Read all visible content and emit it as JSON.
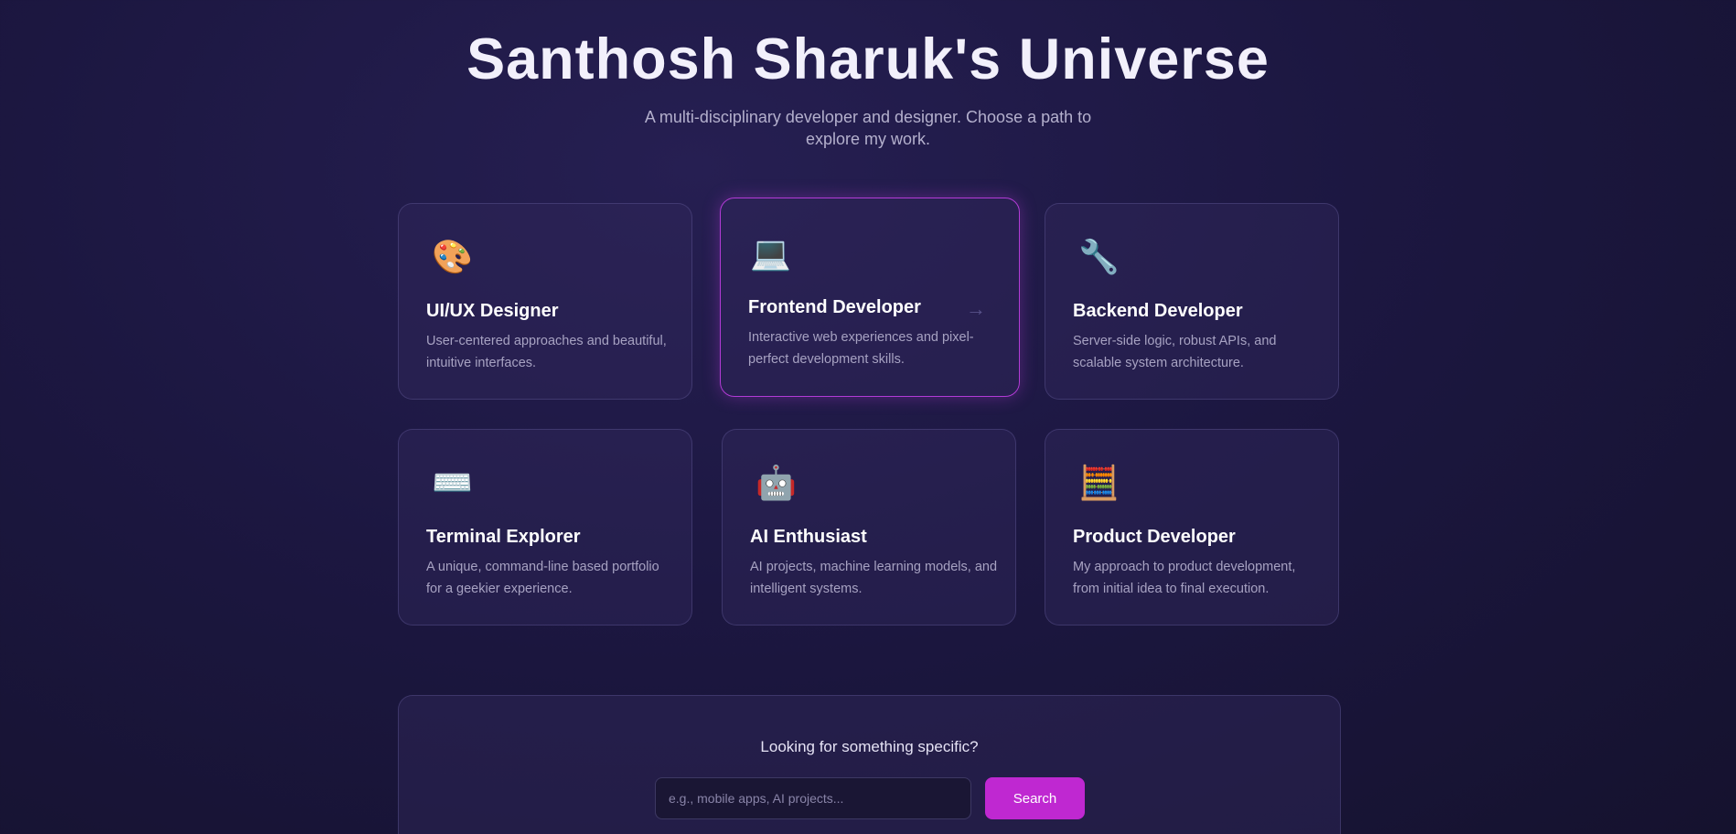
{
  "header": {
    "title": "Santhosh Sharuk's Universe",
    "subtitle": "A multi-disciplinary developer and designer. Choose a path to explore my work."
  },
  "cards": [
    {
      "icon": "palette-icon",
      "glyph": "🎨",
      "title": "UI/UX Designer",
      "description": "User-centered approaches and beautiful, intuitive interfaces."
    },
    {
      "icon": "laptop-icon",
      "glyph": "💻",
      "title": "Frontend Developer",
      "description": "Interactive web experiences and pixel-perfect development skills.",
      "arrow": "→"
    },
    {
      "icon": "wrench-icon",
      "glyph": "🔧",
      "title": "Backend Developer",
      "description": "Server-side logic, robust APIs, and scalable system architecture."
    },
    {
      "icon": "keyboard-icon",
      "glyph": "⌨️",
      "title": "Terminal Explorer",
      "description": "A unique, command-line based portfolio for a geekier experience."
    },
    {
      "icon": "robot-icon",
      "glyph": "🤖",
      "title": "AI Enthusiast",
      "description": "AI projects, machine learning models, and intelligent systems."
    },
    {
      "icon": "calculator-icon",
      "glyph": "🧮",
      "title": "Product Developer",
      "description": "My approach to product development, from initial idea to final execution."
    }
  ],
  "search": {
    "heading": "Looking for something specific?",
    "placeholder": "e.g., mobile apps, AI projects...",
    "button_label": "Search"
  },
  "colors": {
    "accent": "#bf28d1",
    "background": "#1c1741"
  }
}
